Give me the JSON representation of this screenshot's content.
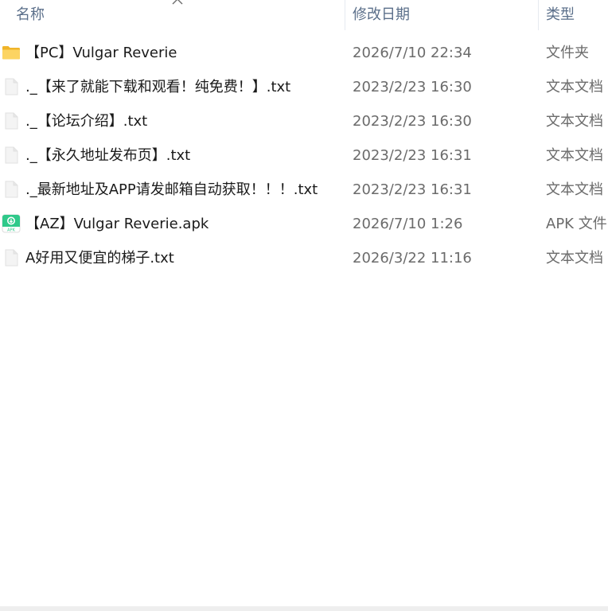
{
  "header": {
    "name_label": "名称",
    "date_label": "修改日期",
    "type_label": "类型"
  },
  "files": [
    {
      "icon": "folder-icon",
      "name": "【PC】Vulgar Reverie",
      "date": "2026/7/10 22:34",
      "type": "文件夹"
    },
    {
      "icon": "text-file-icon",
      "name": "._【来了就能下载和观看！纯免费！】.txt",
      "date": "2023/2/23 16:30",
      "type": "文本文档"
    },
    {
      "icon": "text-file-icon",
      "name": "._【论坛介绍】.txt",
      "date": "2023/2/23 16:30",
      "type": "文本文档"
    },
    {
      "icon": "text-file-icon",
      "name": "._【永久地址发布页】.txt",
      "date": "2023/2/23 16:31",
      "type": "文本文档"
    },
    {
      "icon": "text-file-icon",
      "name": "._最新地址及APP请发邮箱自动获取！！！.txt",
      "date": "2023/2/23 16:31",
      "type": "文本文档"
    },
    {
      "icon": "apk-file-icon",
      "icon_label": "APK",
      "name": "【AZ】Vulgar Reverie.apk",
      "date": "2026/7/10 1:26",
      "type": "APK 文件"
    },
    {
      "icon": "text-file-icon",
      "name": "A好用又便宜的梯子.txt",
      "date": "2026/3/22 11:16",
      "type": "文本文档"
    }
  ],
  "colors": {
    "header_text": "#5b6f8a",
    "folder": "#f8c73a",
    "apk": "#3ddc84"
  }
}
